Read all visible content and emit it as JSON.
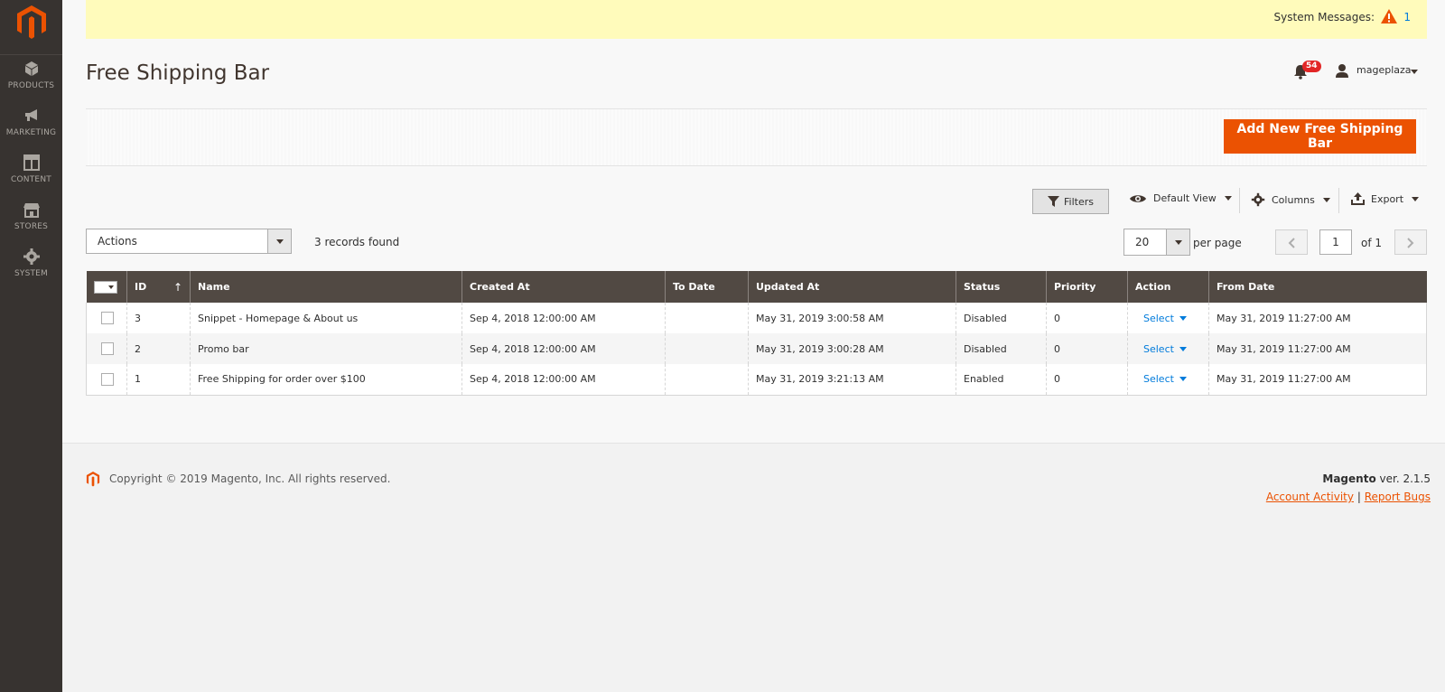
{
  "sidebar": {
    "items": [
      {
        "label": "PRODUCTS",
        "icon": "cube-icon"
      },
      {
        "label": "MARKETING",
        "icon": "megaphone-icon"
      },
      {
        "label": "CONTENT",
        "icon": "layout-icon"
      },
      {
        "label": "STORES",
        "icon": "storefront-icon"
      },
      {
        "label": "SYSTEM",
        "icon": "gear-icon"
      }
    ]
  },
  "system_messages": {
    "label": "System Messages:",
    "count": "1"
  },
  "header": {
    "title": "Free Shipping Bar",
    "notifications_count": "54",
    "username": "mageplaza"
  },
  "primary_action": {
    "label": "Add New Free Shipping Bar"
  },
  "toolbar": {
    "filters_label": "Filters",
    "view_label": "Default View",
    "columns_label": "Columns",
    "export_label": "Export"
  },
  "mass_actions": {
    "label": "Actions"
  },
  "records_found": "3 records found",
  "pagination": {
    "per_page_value": "20",
    "per_page_label": "per page",
    "current_page": "1",
    "of_label": "of 1"
  },
  "grid": {
    "columns": [
      "ID",
      "Name",
      "Created At",
      "To Date",
      "Updated At",
      "Status",
      "Priority",
      "Action",
      "From Date"
    ],
    "sort_indicator": "↑",
    "rows": [
      {
        "id": "3",
        "name": "Snippet - Homepage & About us",
        "created_at": "Sep 4, 2018 12:00:00 AM",
        "to_date": "",
        "updated_at": "May 31, 2019 3:00:58 AM",
        "status": "Disabled",
        "priority": "0",
        "action": "Select",
        "from_date": "May 31, 2019 11:27:00 AM"
      },
      {
        "id": "2",
        "name": "Promo bar",
        "created_at": "Sep 4, 2018 12:00:00 AM",
        "to_date": "",
        "updated_at": "May 31, 2019 3:00:28 AM",
        "status": "Disabled",
        "priority": "0",
        "action": "Select",
        "from_date": "May 31, 2019 11:27:00 AM"
      },
      {
        "id": "1",
        "name": "Free Shipping for order over $100",
        "created_at": "Sep 4, 2018 12:00:00 AM",
        "to_date": "",
        "updated_at": "May 31, 2019 3:21:13 AM",
        "status": "Enabled",
        "priority": "0",
        "action": "Select",
        "from_date": "May 31, 2019 11:27:00 AM"
      }
    ]
  },
  "footer": {
    "copyright": "Copyright © 2019 Magento, Inc. All rights reserved.",
    "brand": "Magento",
    "version": "ver. 2.1.5",
    "account_activity": "Account Activity",
    "separator": "|",
    "report_bugs": "Report Bugs"
  },
  "colors": {
    "accent": "#eb5202",
    "sidebar": "#373330",
    "grid_header": "#514943",
    "link": "#007bdb",
    "system_bar": "#fffbbb"
  }
}
